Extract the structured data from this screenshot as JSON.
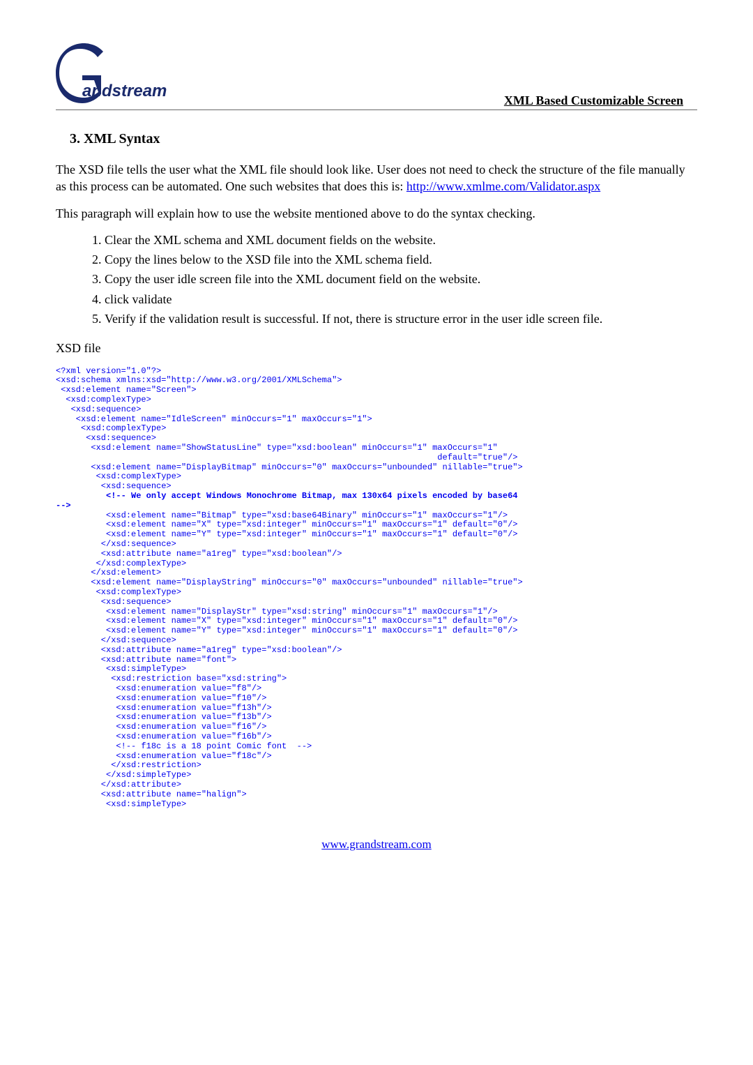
{
  "header": {
    "logo_text": "Grandstream",
    "doc_title": "XML Based Customizable Screen"
  },
  "section": {
    "heading": "3.  XML Syntax"
  },
  "intro": {
    "p1a": "The XSD file tells the user what the XML file should look like. User does not need to check the structure of the file manually as this process can be automated. One such websites that does this is: ",
    "p1_link": "http://www.xmlme.com/Validator.aspx",
    "p2": "This paragraph will explain how to use the website mentioned above to do the syntax checking."
  },
  "steps": [
    "Clear the XML schema and XML document fields on the website.",
    "Copy the lines below to the XSD file into the XML schema field.",
    "Copy the user idle screen file into the XML document field on the website.",
    "click validate",
    "Verify if the validation result is successful. If not, there is structure error in the user idle screen file."
  ],
  "xsd_label": "XSD file",
  "code": "<?xml version=\"1.0\"?>\n<xsd:schema xmlns:xsd=\"http://www.w3.org/2001/XMLSchema\">\n <xsd:element name=\"Screen\">\n  <xsd:complexType>\n   <xsd:sequence>\n    <xsd:element name=\"IdleScreen\" minOccurs=\"1\" maxOccurs=\"1\">\n     <xsd:complexType>\n      <xsd:sequence>\n       <xsd:element name=\"ShowStatusLine\" type=\"xsd:boolean\" minOccurs=\"1\" maxOccurs=\"1\"\n                                                                            default=\"true\"/>\n       <xsd:element name=\"DisplayBitmap\" minOccurs=\"0\" maxOccurs=\"unbounded\" nillable=\"true\">\n        <xsd:complexType>\n         <xsd:sequence>",
  "code_bold": "          <!-- We only accept Windows Monochrome Bitmap, max 130x64 pixels encoded by base64\n-->",
  "code2": "          <xsd:element name=\"Bitmap\" type=\"xsd:base64Binary\" minOccurs=\"1\" maxOccurs=\"1\"/>\n          <xsd:element name=\"X\" type=\"xsd:integer\" minOccurs=\"1\" maxOccurs=\"1\" default=\"0\"/>\n          <xsd:element name=\"Y\" type=\"xsd:integer\" minOccurs=\"1\" maxOccurs=\"1\" default=\"0\"/>\n         </xsd:sequence>\n         <xsd:attribute name=\"a1reg\" type=\"xsd:boolean\"/>\n        </xsd:complexType>\n       </xsd:element>\n       <xsd:element name=\"DisplayString\" minOccurs=\"0\" maxOccurs=\"unbounded\" nillable=\"true\">\n        <xsd:complexType>\n         <xsd:sequence>\n          <xsd:element name=\"DisplayStr\" type=\"xsd:string\" minOccurs=\"1\" maxOccurs=\"1\"/>\n          <xsd:element name=\"X\" type=\"xsd:integer\" minOccurs=\"1\" maxOccurs=\"1\" default=\"0\"/>\n          <xsd:element name=\"Y\" type=\"xsd:integer\" minOccurs=\"1\" maxOccurs=\"1\" default=\"0\"/>\n         </xsd:sequence>\n         <xsd:attribute name=\"a1reg\" type=\"xsd:boolean\"/>\n         <xsd:attribute name=\"font\">\n          <xsd:simpleType>\n           <xsd:restriction base=\"xsd:string\">\n            <xsd:enumeration value=\"f8\"/>\n            <xsd:enumeration value=\"f10\"/>\n            <xsd:enumeration value=\"f13h\"/>\n            <xsd:enumeration value=\"f13b\"/>\n            <xsd:enumeration value=\"f16\"/>\n            <xsd:enumeration value=\"f16b\"/>\n            <!-- f18c is a 18 point Comic font  -->\n            <xsd:enumeration value=\"f18c\"/>\n           </xsd:restriction>\n          </xsd:simpleType>\n         </xsd:attribute>\n         <xsd:attribute name=\"halign\">\n          <xsd:simpleType>",
  "footer": {
    "link": "www.grandstream.com"
  }
}
